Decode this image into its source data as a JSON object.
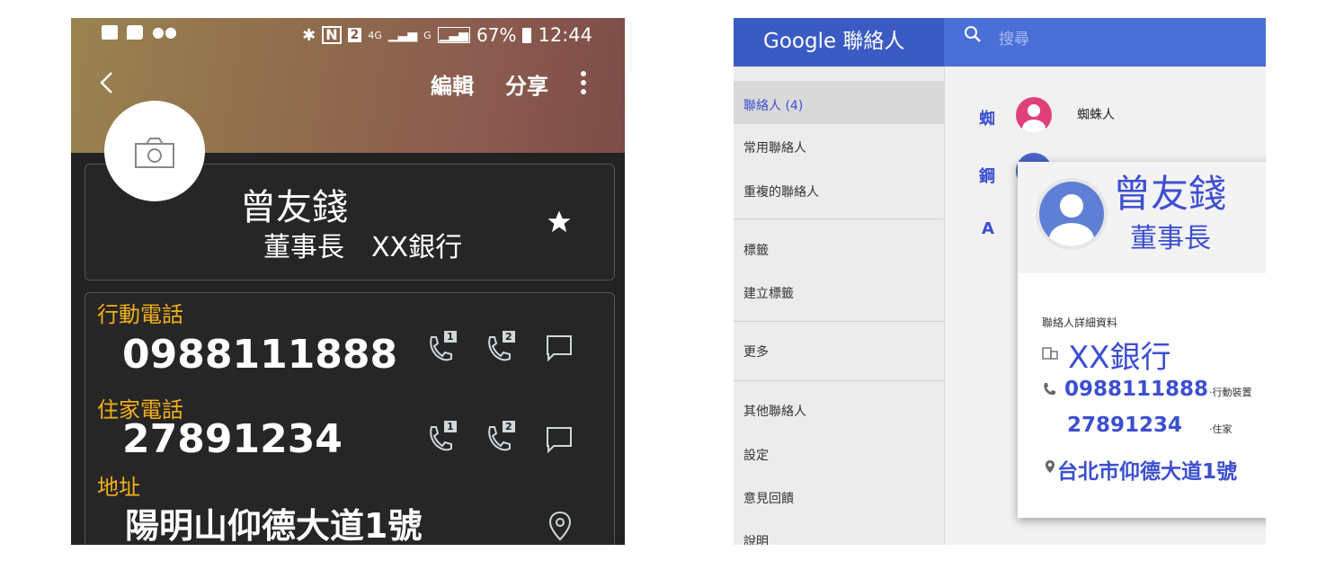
{
  "phone": {
    "status_right": "67%",
    "status_time": "12:44",
    "status_sim": "2",
    "status_net": "4G",
    "status_g": "G",
    "actions": {
      "edit": "編輯",
      "share": "分享"
    },
    "contact": {
      "name": "曾友錢",
      "title_company": "董事長　XX銀行"
    },
    "fields": {
      "mobile_label": "行動電話",
      "mobile_value": "0988111888",
      "home_label": "住家電話",
      "home_value": "27891234",
      "address_label": "地址",
      "address_value": "陽明山仰德大道1號"
    },
    "sim1": "1",
    "sim2": "2"
  },
  "google": {
    "logo": "Google 聯絡人",
    "search_placeholder": "搜尋",
    "sidebar": [
      {
        "label": "聯絡人 (4)"
      },
      {
        "label": "常用聯絡人"
      },
      {
        "label": "重複的聯絡人"
      },
      {
        "label": "標籤"
      },
      {
        "label": "建立標籤"
      },
      {
        "label": "更多"
      },
      {
        "label": "其他聯絡人"
      },
      {
        "label": "設定"
      },
      {
        "label": "意見回饋"
      },
      {
        "label": "說明"
      }
    ],
    "list": {
      "letter1": "蜘",
      "name1": "蜘蛛人",
      "letter2": "鋼",
      "letter3": "A"
    },
    "popup": {
      "name": "曾友錢",
      "title": "董事長",
      "details_heading": "聯絡人詳細資料",
      "company": "XX銀行",
      "mobile": "0988111888",
      "mobile_type": "‧行動裝置",
      "home": "27891234",
      "home_type": "‧住家",
      "address": "台北市仰德大道1號"
    }
  }
}
